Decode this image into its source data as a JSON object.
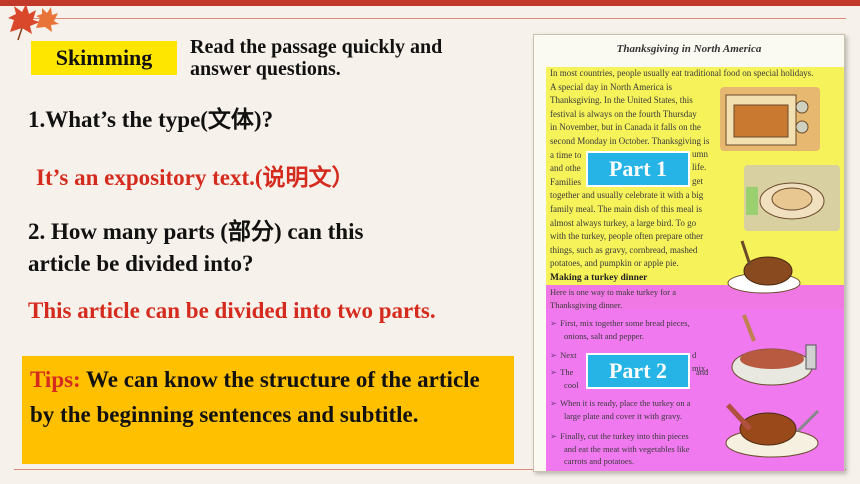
{
  "badge": "Skimming",
  "instruction": [
    "Read the passage quickly and",
    "answer questions."
  ],
  "q1": "1.What’s the type(文体)?",
  "a1": "It’s an expository text.(说明文）",
  "q2": [
    "2. How many parts (部分) can this",
    "article be divided into?"
  ],
  "a2": "This article can be divided into two parts.",
  "tips": {
    "label": "Tips:",
    "text": " We can know the structure of the article by the beginning sentences and subtitle."
  },
  "passage": {
    "title": "Thanksgiving in North America",
    "intro": [
      "In most countries, people usually eat traditional food on special holidays.",
      "A special day in North America is",
      "Thanksgiving. In the United States, this",
      "festival is always on the fourth Thursday",
      "in November, but in Canada it falls on the",
      "second Monday in October. Thanksgiving is",
      "a time to",
      "and othe",
      "Families",
      "together and usually celebrate it with a big",
      "family meal. The main dish of this meal is",
      "almost always turkey, a large bird. To go",
      "with the turkey, people often prepare other",
      "things, such as gravy, cornbread, mashed",
      "potatoes, and pumpkin or apple pie."
    ],
    "intro_right": [
      "umn",
      "life.",
      "get"
    ],
    "subtitle": "Making a turkey dinner",
    "subintro": [
      "Here is one way to make turkey for a",
      "Thanksgiving dinner."
    ],
    "steps": [
      [
        "First, mix together some bread pieces,",
        "onions, salt and pepper."
      ],
      [
        "Next",
        "d mix."
      ],
      [
        "The",
        "and",
        "cool"
      ],
      [
        "When it is ready, place the turkey on a",
        "large plate and cover it with gravy."
      ],
      [
        "Finally, cut the turkey into thin pieces",
        "and eat the meat with vegetables like",
        "carrots and potatoes."
      ]
    ]
  },
  "part1": "Part 1",
  "part2": "Part 2",
  "colors": {
    "badge": "#ffe600",
    "tips_bg": "#ffc000",
    "answer": "#d52b1e",
    "part_label": "#26b4e6",
    "highlight_yellow": "#f6f25a",
    "highlight_pink": "#ef6ef0"
  }
}
